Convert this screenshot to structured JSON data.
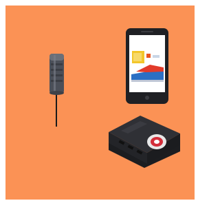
{
  "colors": {
    "background": "#fb9255",
    "page": "#ffffff",
    "sensor_body": "#4a4e57",
    "phone_body": "#1f2024",
    "router_body": "#2c2d31",
    "router_badge": "#e8e8e8"
  },
  "items": [
    {
      "icon": "tire-pressure-sensor-icon"
    },
    {
      "icon": "smartphone-icon"
    },
    {
      "icon": "router-box-icon"
    }
  ]
}
